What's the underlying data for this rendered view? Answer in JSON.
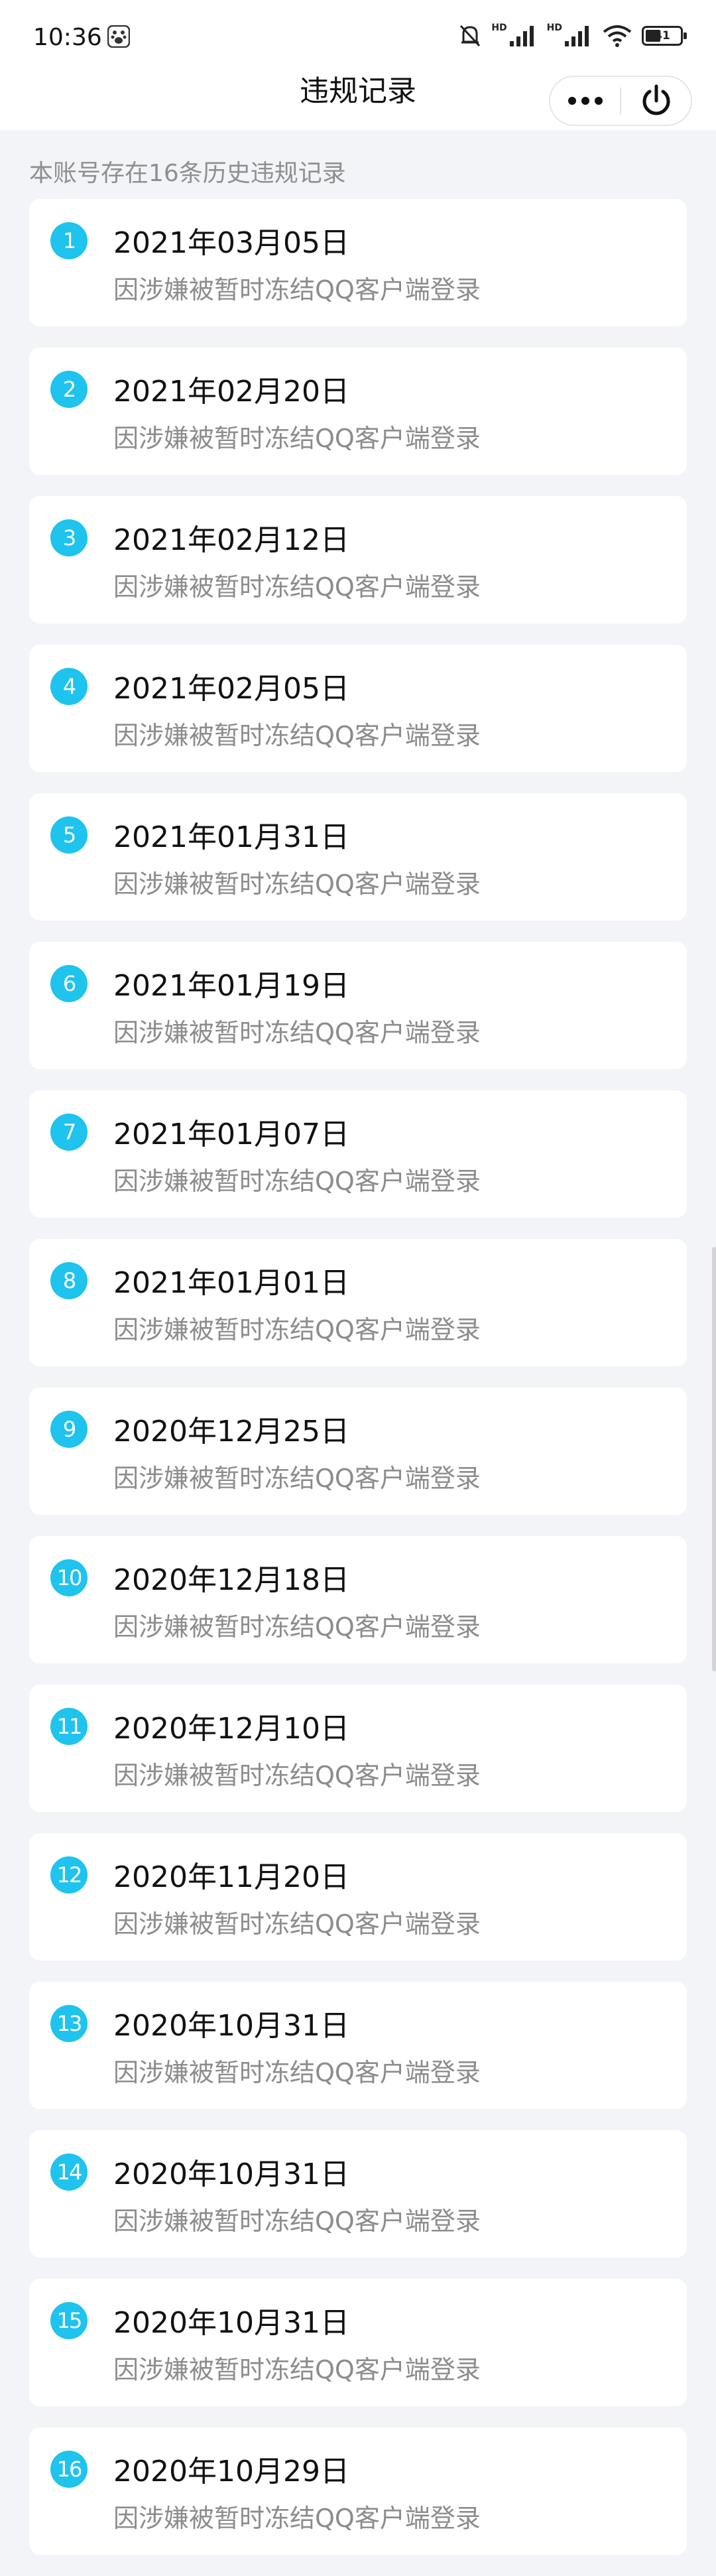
{
  "status_bar": {
    "time": "10:36",
    "battery": "41",
    "network_labels": [
      "HD",
      "HD"
    ]
  },
  "header": {
    "title": "违规记录"
  },
  "summary": "本账号存在16条历史违规记录",
  "records": [
    {
      "num": "1",
      "date": "2021年03月05日",
      "reason": "因涉嫌被暂时冻结QQ客户端登录"
    },
    {
      "num": "2",
      "date": "2021年02月20日",
      "reason": "因涉嫌被暂时冻结QQ客户端登录"
    },
    {
      "num": "3",
      "date": "2021年02月12日",
      "reason": "因涉嫌被暂时冻结QQ客户端登录"
    },
    {
      "num": "4",
      "date": "2021年02月05日",
      "reason": "因涉嫌被暂时冻结QQ客户端登录"
    },
    {
      "num": "5",
      "date": "2021年01月31日",
      "reason": "因涉嫌被暂时冻结QQ客户端登录"
    },
    {
      "num": "6",
      "date": "2021年01月19日",
      "reason": "因涉嫌被暂时冻结QQ客户端登录"
    },
    {
      "num": "7",
      "date": "2021年01月07日",
      "reason": "因涉嫌被暂时冻结QQ客户端登录"
    },
    {
      "num": "8",
      "date": "2021年01月01日",
      "reason": "因涉嫌被暂时冻结QQ客户端登录"
    },
    {
      "num": "9",
      "date": "2020年12月25日",
      "reason": "因涉嫌被暂时冻结QQ客户端登录"
    },
    {
      "num": "10",
      "date": "2020年12月18日",
      "reason": "因涉嫌被暂时冻结QQ客户端登录"
    },
    {
      "num": "11",
      "date": "2020年12月10日",
      "reason": "因涉嫌被暂时冻结QQ客户端登录"
    },
    {
      "num": "12",
      "date": "2020年11月20日",
      "reason": "因涉嫌被暂时冻结QQ客户端登录"
    },
    {
      "num": "13",
      "date": "2020年10月31日",
      "reason": "因涉嫌被暂时冻结QQ客户端登录"
    },
    {
      "num": "14",
      "date": "2020年10月31日",
      "reason": "因涉嫌被暂时冻结QQ客户端登录"
    },
    {
      "num": "15",
      "date": "2020年10月31日",
      "reason": "因涉嫌被暂时冻结QQ客户端登录"
    },
    {
      "num": "16",
      "date": "2020年10月29日",
      "reason": "因涉嫌被暂时冻结QQ客户端登录"
    }
  ],
  "colors": {
    "badge": "#1ec3ee",
    "background": "#f3f4f8",
    "card": "#ffffff",
    "secondary_text": "#8c8c8c"
  },
  "icons": {
    "status": [
      "paw-icon",
      "mute-bell-icon",
      "signal-icon",
      "wifi-icon",
      "battery-icon"
    ],
    "capsule": [
      "more-icon",
      "power-icon"
    ]
  }
}
